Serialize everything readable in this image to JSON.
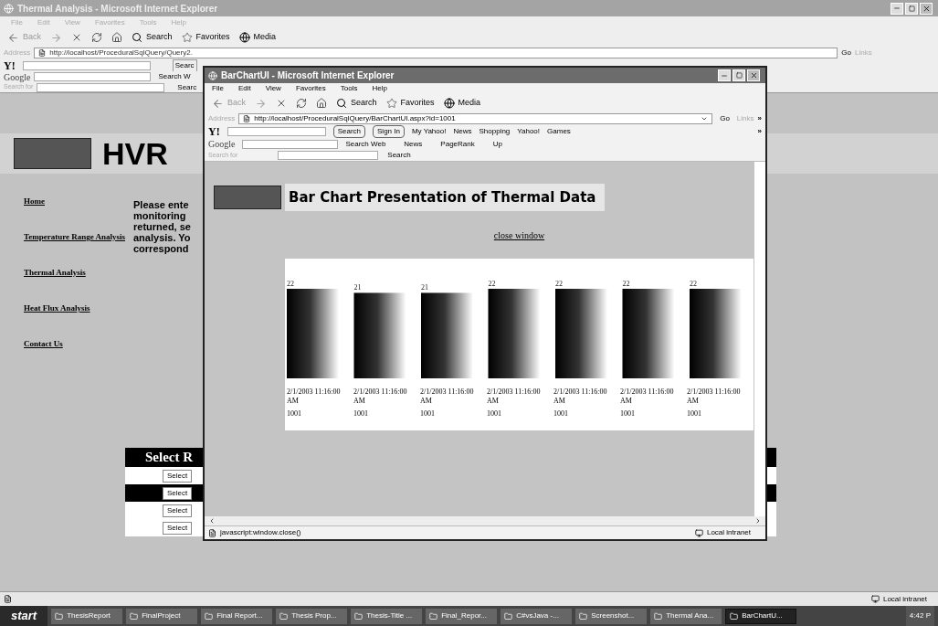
{
  "background_window": {
    "title": "Thermal Analysis - Microsoft Internet Explorer",
    "menu": [
      "File",
      "Edit",
      "View",
      "Favorites",
      "Tools",
      "Help"
    ],
    "toolbar": {
      "back": "Back",
      "search": "Search",
      "favorites": "Favorites",
      "media": "Media"
    },
    "address_label": "Address",
    "address": "http://localhost/ProceduralSqlQuery/Query2.",
    "go": "Go",
    "links": "Links",
    "yahoo_logo": "Y!",
    "yahoo_search": "Searc",
    "google_logo": "Google",
    "google_search_web": "Search W",
    "search_for_label": "Search for",
    "search_button": "Searc",
    "site_title": "HVR",
    "nav": [
      "Home",
      "Temperature Range Analysis",
      "Thermal Analysis",
      "Heat Flux Analysis",
      "Contact Us"
    ],
    "intro_lines": [
      "Please ente",
      "monitoring",
      "returned, se",
      "analysis. Yo",
      "correspond"
    ],
    "table_heading": "Select R",
    "rows": [
      {
        "button": "Select",
        "shaded": false
      },
      {
        "button": "Select",
        "shaded": true
      },
      {
        "button": "Select",
        "shaded": false
      },
      {
        "button": "Select",
        "shaded": false
      }
    ],
    "status": "Local intranet"
  },
  "popup_window": {
    "title": "BarChartUI - Microsoft Internet Explorer",
    "menu": [
      "File",
      "Edit",
      "View",
      "Favorites",
      "Tools",
      "Help"
    ],
    "toolbar": {
      "back": "Back",
      "search": "Search",
      "favorites": "Favorites",
      "media": "Media"
    },
    "address_label": "Address",
    "address": "http://localhost/ProceduralSqlQuery/BarChartUI.aspx?id=1001",
    "go": "Go",
    "links": "Links",
    "more": "»",
    "yahoo_logo": "Y!",
    "yahoo_search": "Search",
    "sign_in": "Sign In",
    "yahoo_links": [
      "My Yahoo!",
      "News",
      "Shopping",
      "Yahoo!",
      "Games"
    ],
    "google_logo": "Google",
    "google_search_web": "Search Web",
    "google_links": [
      "News",
      "PageRank",
      "Up"
    ],
    "search_for_label": "Search for",
    "search_button": "Search",
    "page_title": "Bar Chart Presentation of Thermal Data",
    "close_link": "close window",
    "chart_data": {
      "type": "bar",
      "categories": [
        "2/1/2003 11:16:00 AM",
        "2/1/2003 11:16:00 AM",
        "2/1/2003 11:16:00 AM",
        "2/1/2003 11:16:00 AM",
        "2/1/2003 11:16:00 AM",
        "2/1/2003 11:16:00 AM",
        "2/1/2003 11:16:00 AM"
      ],
      "values": [
        22,
        21,
        21,
        22,
        22,
        22,
        22
      ],
      "data_labels": true
    },
    "sensor_ids": [
      "1001",
      "1001",
      "1001",
      "1001",
      "1001",
      "1001",
      "1001"
    ],
    "status": "javascript:window.close()",
    "zone": "Local intranet"
  },
  "taskbar": {
    "start": "start",
    "tasks": [
      {
        "label": "ThesisReport",
        "selected": false
      },
      {
        "label": "FinalProject",
        "selected": false
      },
      {
        "label": "Final Report...",
        "selected": false
      },
      {
        "label": "Thesis Prop...",
        "selected": false
      },
      {
        "label": "Thesis-Title ...",
        "selected": false
      },
      {
        "label": "Final_Repor...",
        "selected": false
      },
      {
        "label": "C#vsJava -...",
        "selected": false
      },
      {
        "label": "Screenshot...",
        "selected": false
      },
      {
        "label": "Thermal Ana...",
        "selected": false
      },
      {
        "label": "BarChartU...",
        "selected": true
      }
    ],
    "clock": "4:42 P"
  }
}
